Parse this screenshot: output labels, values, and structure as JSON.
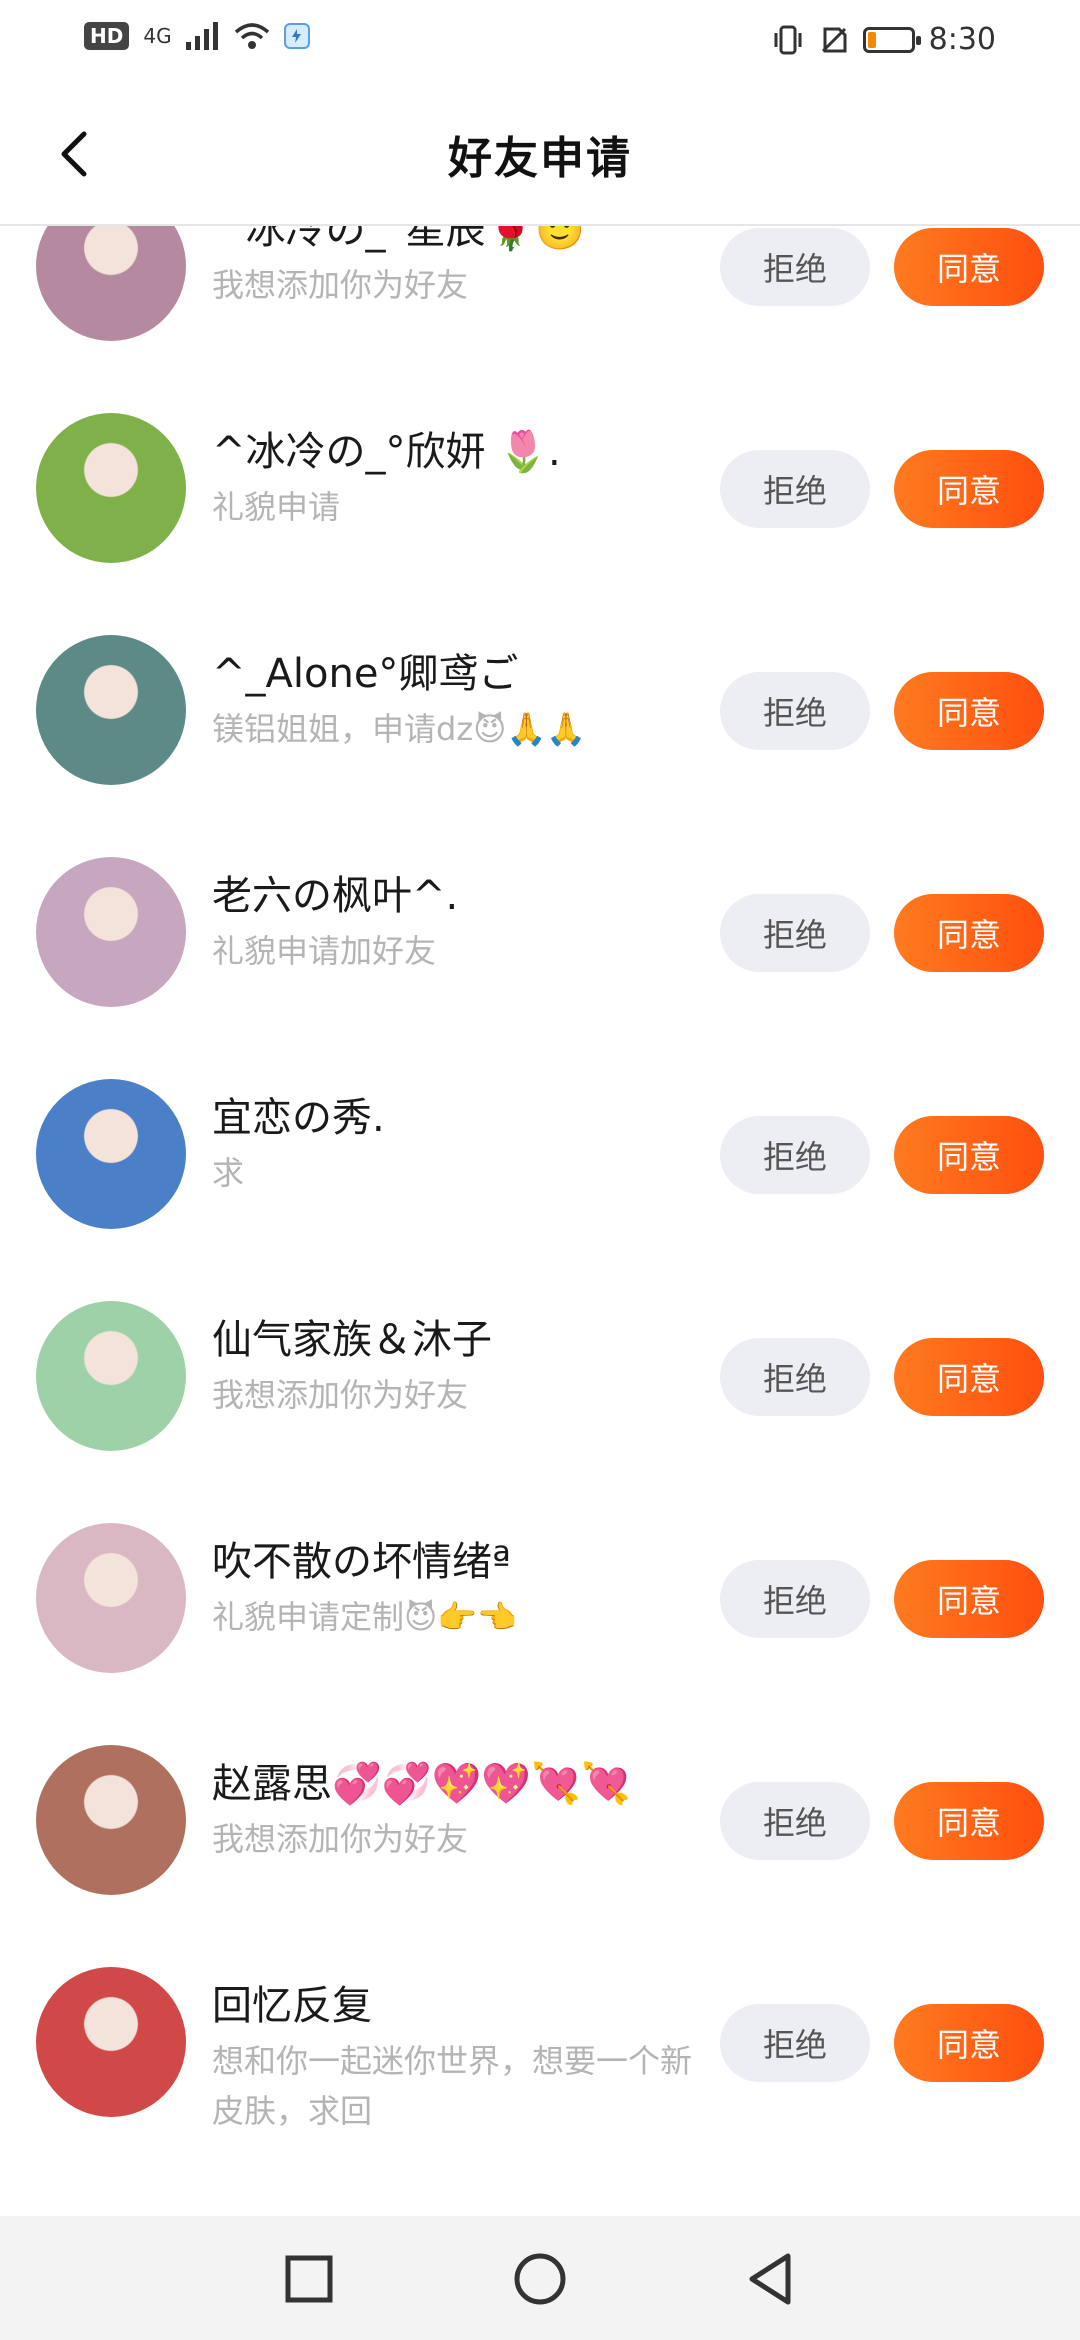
{
  "status": {
    "hd": "HD",
    "network": "4G",
    "time": "8:30",
    "battery_level": 0.2,
    "battery_color": "#f28b00"
  },
  "header": {
    "title": "好友申请",
    "back_icon": "back-arrow-icon"
  },
  "actions": {
    "reject_label": "拒绝",
    "agree_label": "同意"
  },
  "requests": [
    {
      "name": "^冰冷の_°星辰🌹🙂",
      "message": "我想添加你为好友"
    },
    {
      "name": "^冰冷の_°欣妍 🌷.",
      "message": "礼貌申请"
    },
    {
      "name": "^_Alone°卿鸢ご",
      "message": "镁铝姐姐，申请dz😈🙏🙏"
    },
    {
      "name": "老六の枫叶^.",
      "message": "礼貌申请加好友"
    },
    {
      "name": "宜恋の秀.",
      "message": "求"
    },
    {
      "name": "仙气家族＆沐子",
      "message": "我想添加你为好友"
    },
    {
      "name": "吹不散の坏情绪ª",
      "message": "礼貌申请定制😈👉👈"
    },
    {
      "name": "赵露思💞💞💖💖💘💘",
      "message": "我想添加你为好友"
    },
    {
      "name": "回忆反复",
      "message": "想和你一起迷你世界，想要一个新皮肤，求回"
    }
  ],
  "avatar_colors": [
    "#b58aa0",
    "#7fb04a",
    "#5d8a86",
    "#c7a6c0",
    "#4b7fc8",
    "#9fd1a8",
    "#d9b8c4",
    "#b07060",
    "#d04848"
  ],
  "accent": {
    "agree_gradient": [
      "#ff7b1f",
      "#ff4f0f"
    ],
    "reject_bg": "#eceef3"
  },
  "nav": {
    "icons": [
      "square-icon",
      "circle-home-icon",
      "triangle-back-icon"
    ]
  }
}
